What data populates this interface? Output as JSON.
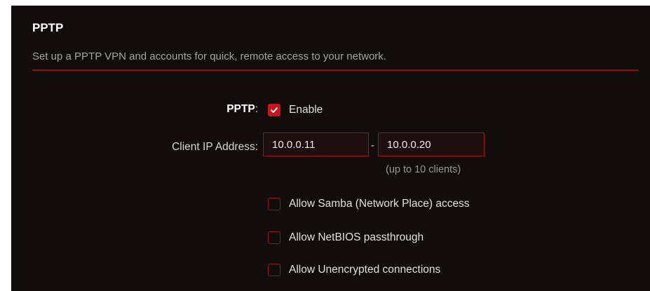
{
  "section": {
    "title": "PPTP",
    "description": "Set up a PPTP VPN and accounts for quick, remote access to your network."
  },
  "pptp": {
    "label": "PPTP",
    "label_suffix": ":",
    "enable_label": "Enable",
    "enabled": true
  },
  "client_ip": {
    "label": "Client IP Address:",
    "start_value": "10.0.0.11",
    "end_value": "10.0.0.20",
    "separator": "-",
    "hint": "(up to 10 clients)"
  },
  "options": [
    {
      "label": "Allow Samba (Network Place) access",
      "checked": false
    },
    {
      "label": "Allow NetBIOS passthrough",
      "checked": false
    },
    {
      "label": "Allow Unencrypted connections",
      "checked": false
    }
  ],
  "colors": {
    "background": "#120d0c",
    "accent": "#c8141d",
    "divider": "#8a0f12",
    "input_border": "#9b1317"
  }
}
